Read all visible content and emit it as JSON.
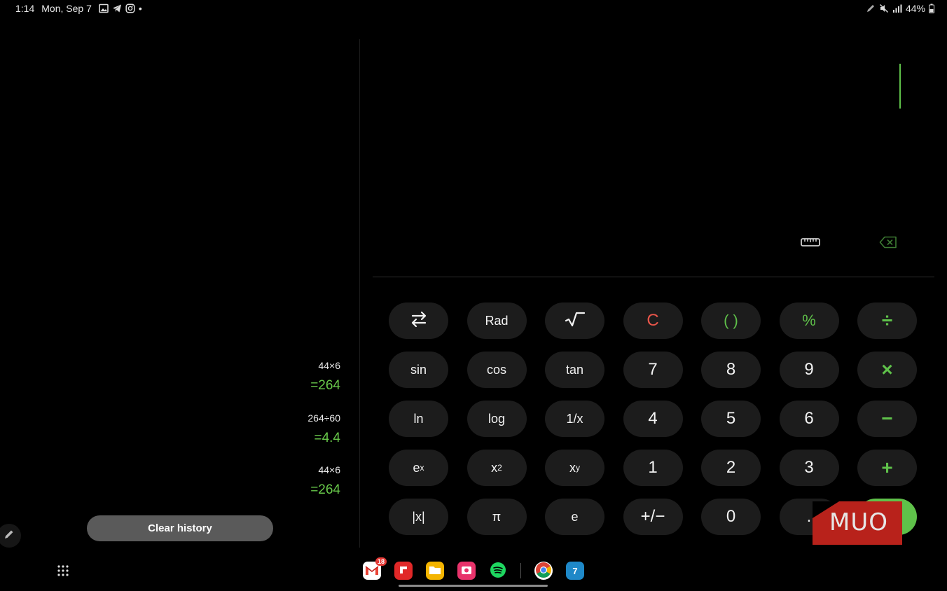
{
  "status_bar": {
    "time": "1:14",
    "date": "Mon, Sep 7",
    "notification_icons": [
      "gallery-icon",
      "telegram-icon",
      "instagram-icon"
    ],
    "more_dot": "•",
    "battery": "44%"
  },
  "history": {
    "entries": [
      {
        "expression": "44×6",
        "result": "=264"
      },
      {
        "expression": "264÷60",
        "result": "=4.4"
      },
      {
        "expression": "44×6",
        "result": "=264"
      }
    ],
    "clear_label": "Clear history"
  },
  "keypad": {
    "row1": [
      "⇆",
      "Rad",
      "√",
      "C",
      "( )",
      "%",
      "÷"
    ],
    "row2": [
      "sin",
      "cos",
      "tan",
      "7",
      "8",
      "9",
      "×"
    ],
    "row3": [
      "ln",
      "log",
      "1/x",
      "4",
      "5",
      "6",
      "−"
    ],
    "row4": {
      "ex_base": "e",
      "ex_sup": "x",
      "x2_base": "x",
      "x2_sup": "2",
      "xy_base": "x",
      "xy_sup": "y",
      "one": "1",
      "two": "2",
      "three": "3",
      "plus": "+"
    },
    "row5": [
      "|x|",
      "π",
      "e",
      "+/−",
      "0",
      ".",
      "="
    ]
  },
  "watermark": {
    "text": "MUO"
  },
  "dock": {
    "apps": [
      "Gmail",
      "Flipboard",
      "My Files",
      "Screen Recorder",
      "Spotify",
      "Chrome",
      "Calendar"
    ],
    "gmail_badge": "18",
    "calendar_day": "7"
  },
  "colors": {
    "accent": "#5fc14a",
    "clear": "#e8554a",
    "key_bg": "#1c1c1c"
  }
}
